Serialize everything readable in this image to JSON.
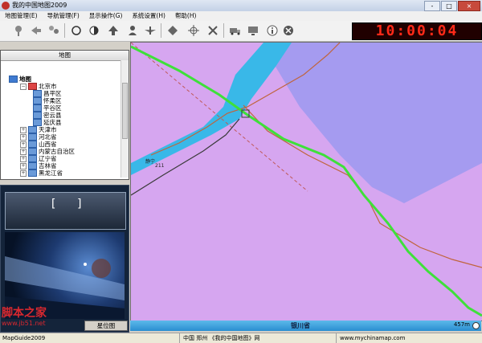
{
  "window": {
    "title": "我的中国地图2009",
    "controls": [
      "-",
      "□",
      "×"
    ]
  },
  "menu": [
    "地图管理(E)",
    "导航管理(F)",
    "显示操作(G)",
    "系统设置(H)",
    "帮助(H)"
  ],
  "toolbar": {
    "icons": [
      "pin-icon",
      "back-arrow-icon",
      "multi-pin-icon",
      "circle-icon",
      "half-circle-icon",
      "up-arrow-icon",
      "user-icon",
      "wing-icon",
      "diamond-icon",
      "crosshair-icon",
      "tools-icon",
      "truck-icon",
      "monitor-icon",
      "info-icon",
      "stop-icon"
    ],
    "clock": "10:00:04"
  },
  "map_tree": {
    "header": "地图",
    "root": "地图",
    "items": [
      {
        "label": "北京市",
        "level": 1,
        "selected": true
      },
      {
        "label": "昌平区",
        "level": 2
      },
      {
        "label": "怀柔区",
        "level": 2
      },
      {
        "label": "平谷区",
        "level": 2
      },
      {
        "label": "密云县",
        "level": 2
      },
      {
        "label": "延庆县",
        "level": 2
      },
      {
        "label": "天津市",
        "level": 1
      },
      {
        "label": "河北省",
        "level": 1
      },
      {
        "label": "山西省",
        "level": 1
      },
      {
        "label": "内蒙古自治区",
        "level": 1
      },
      {
        "label": "辽宁省",
        "level": 1
      },
      {
        "label": "吉林省",
        "level": 1
      },
      {
        "label": "黑龙江省",
        "level": 1
      }
    ]
  },
  "preview": {
    "bracket_left": "[",
    "bracket_right": "]",
    "button_right": "星位图"
  },
  "map": {
    "colors": {
      "land": "#d6a6f0",
      "water": "#39b8e8",
      "region": "#a59bf0",
      "highway": "#3ee03a",
      "road": "#c0643c"
    },
    "labels": [
      "静宁",
      "211"
    ],
    "province_label": "银川省",
    "scale": "457m"
  },
  "status": {
    "left": "MapGuide2009",
    "middle": "中国 郑州 《我的中国地图》网",
    "right": "www.mychinamap.com"
  },
  "watermark": {
    "text": "脚本之家",
    "url": "www.jb51.net"
  }
}
